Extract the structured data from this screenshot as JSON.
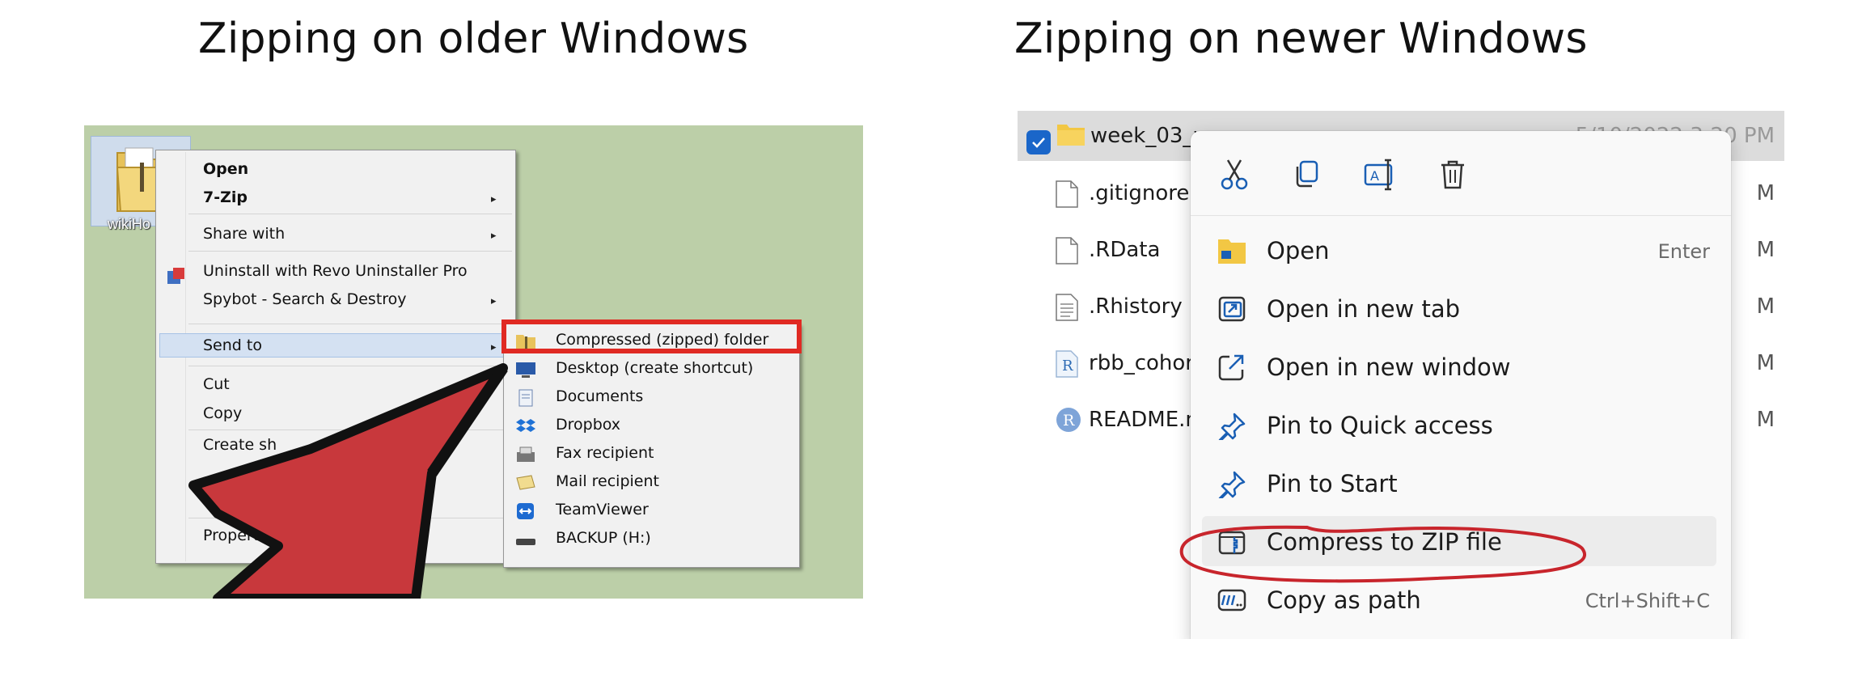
{
  "titles": {
    "left": "Zipping on older Windows",
    "right": "Zipping on newer Windows"
  },
  "old_windows": {
    "desktop_icon_label": "wikiHo",
    "context_menu": {
      "open": "Open",
      "seven_zip": "7-Zip",
      "share_with": "Share with",
      "uninstall": "Uninstall with Revo Uninstaller Pro",
      "spybot": "Spybot - Search & Destroy",
      "send_to": "Send to",
      "cut": "Cut",
      "copy": "Copy",
      "create_shortcut": "Create sh",
      "properties": "Propert",
      "submenu_arrow": "▸"
    },
    "send_to_submenu": [
      {
        "label": "Compressed (zipped) folder",
        "icon": "zip-folder-icon"
      },
      {
        "label": "Desktop (create shortcut)",
        "icon": "desktop-icon"
      },
      {
        "label": "Documents",
        "icon": "documents-icon"
      },
      {
        "label": "Dropbox",
        "icon": "dropbox-icon"
      },
      {
        "label": "Fax recipient",
        "icon": "fax-icon"
      },
      {
        "label": "Mail recipient",
        "icon": "mail-icon"
      },
      {
        "label": "TeamViewer",
        "icon": "teamviewer-icon"
      },
      {
        "label": "BACKUP (H:)",
        "icon": "drive-icon"
      }
    ],
    "highlight_color": "#e02a23",
    "arrow_color": "#c8383c"
  },
  "new_windows": {
    "files": [
      {
        "name": "week_03_w",
        "date": "5/10/2022 3:20 PM",
        "icon": "folder-icon",
        "selected": true
      },
      {
        "name": ".gitignore",
        "date": "M",
        "icon": "file-icon"
      },
      {
        "name": ".RData",
        "date": "M",
        "icon": "file-icon"
      },
      {
        "name": ".Rhistory",
        "date": "M",
        "icon": "text-file-icon"
      },
      {
        "name": "rbb_cohort",
        "date": "M",
        "icon": "r-script-icon"
      },
      {
        "name": "README.m",
        "date": "M",
        "icon": "r-markdown-icon"
      }
    ],
    "quick_actions": [
      "cut-icon",
      "copy-icon",
      "rename-icon",
      "delete-icon"
    ],
    "menu_items": [
      {
        "label": "Open",
        "shortcut": "Enter",
        "icon": "folder-open-icon"
      },
      {
        "label": "Open in new tab",
        "shortcut": "",
        "icon": "new-tab-icon"
      },
      {
        "label": "Open in new window",
        "shortcut": "",
        "icon": "new-window-icon"
      },
      {
        "label": "Pin to Quick access",
        "shortcut": "",
        "icon": "pin-icon"
      },
      {
        "label": "Pin to Start",
        "shortcut": "",
        "icon": "pin-icon"
      },
      {
        "label": "Compress to ZIP file",
        "shortcut": "",
        "icon": "zip-icon"
      },
      {
        "label": "Copy as path",
        "shortcut": "Ctrl+Shift+C",
        "icon": "path-icon"
      }
    ],
    "accent_color": "#1a66c9",
    "circle_color": "#c8252c"
  }
}
